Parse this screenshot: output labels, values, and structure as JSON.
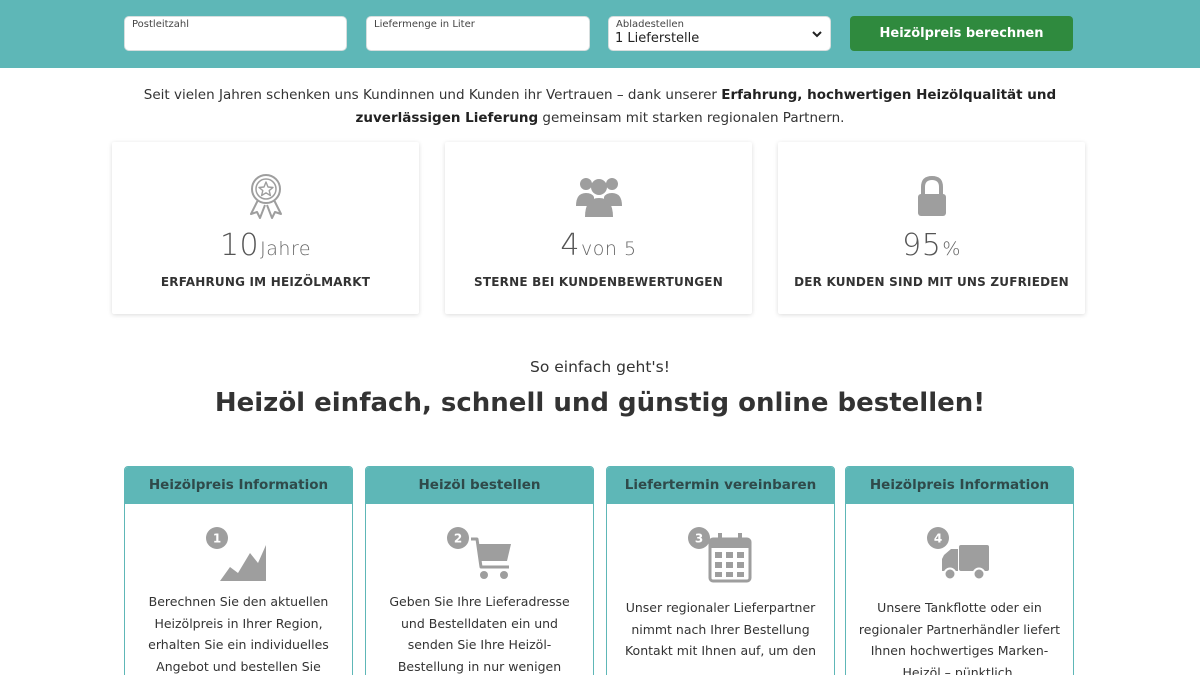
{
  "calculator": {
    "postal_code_label": "Postleitzahl",
    "postal_code_value": "",
    "quantity_label": "Liefermenge in Liter",
    "quantity_value": "",
    "unloading_label": "Abladestellen",
    "unloading_selected": "1 Lieferstelle",
    "submit_label": "Heizölpreis berechnen"
  },
  "intro": {
    "text_before": "Seit vielen Jahren schenken uns Kundinnen und Kunden ihr Vertrauen – dank unserer ",
    "text_bold": "Erfahrung, hochwertigen Heizölqualität und zuverlässigen Lieferung",
    "text_after": " gemeinsam mit starken regionalen Partnern."
  },
  "stats": [
    {
      "icon": "award-ribbon-icon",
      "number": "10",
      "unit": "Jahre",
      "label": "ERFAHRUNG IM HEIZÖLMARKT"
    },
    {
      "icon": "users-group-icon",
      "number": "4",
      "unit": "von 5",
      "label": "STERNE BEI KUNDENBEWERTUNGEN"
    },
    {
      "icon": "lock-icon",
      "number": "95",
      "unit": "%",
      "label": "DER KUNDEN SIND MIT UNS ZUFRIEDEN"
    }
  ],
  "how_it_works": {
    "subtitle": "So einfach geht's!",
    "title": "Heizöl einfach, schnell und günstig online bestellen!"
  },
  "steps": [
    {
      "number": "1",
      "icon": "price-chart-icon",
      "title": "Heizölpreis Information",
      "text": "Berechnen Sie den aktuellen Heizölpreis in Ihrer Region, erhalten Sie ein individuelles Angebot und bestellen Sie"
    },
    {
      "number": "2",
      "icon": "shopping-cart-icon",
      "title": "Heizöl bestellen",
      "text": "Geben Sie Ihre Lieferadresse und Bestelldaten ein und senden Sie Ihre Heizöl-Bestellung in nur wenigen"
    },
    {
      "number": "3",
      "icon": "calendar-icon",
      "title": "Liefertermin vereinbaren",
      "text": "Unser regionaler Lieferpartner nimmt nach Ihrer Bestellung Kontakt mit Ihnen auf, um den"
    },
    {
      "number": "4",
      "icon": "delivery-truck-icon",
      "title": "Heizölpreis Information",
      "text": "Unsere Tankflotte oder ein regionaler Partnerhändler liefert Ihnen hochwertiges Marken-Heizöl – pünktlich,"
    }
  ],
  "colors": {
    "teal": "#5eb7b7",
    "button_green": "#2f8a3e",
    "icon_gray": "#9e9e9e"
  }
}
